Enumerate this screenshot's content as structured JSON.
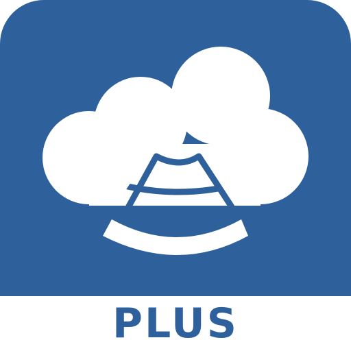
{
  "app_icon": {
    "label": "PLUS",
    "icon_name": "cloud-ultrasound-icon",
    "colors": {
      "tile_background": "#2e619c",
      "cloud": "#ffffff",
      "label_text": "#2e619c",
      "page_background": "#ffffff"
    }
  }
}
